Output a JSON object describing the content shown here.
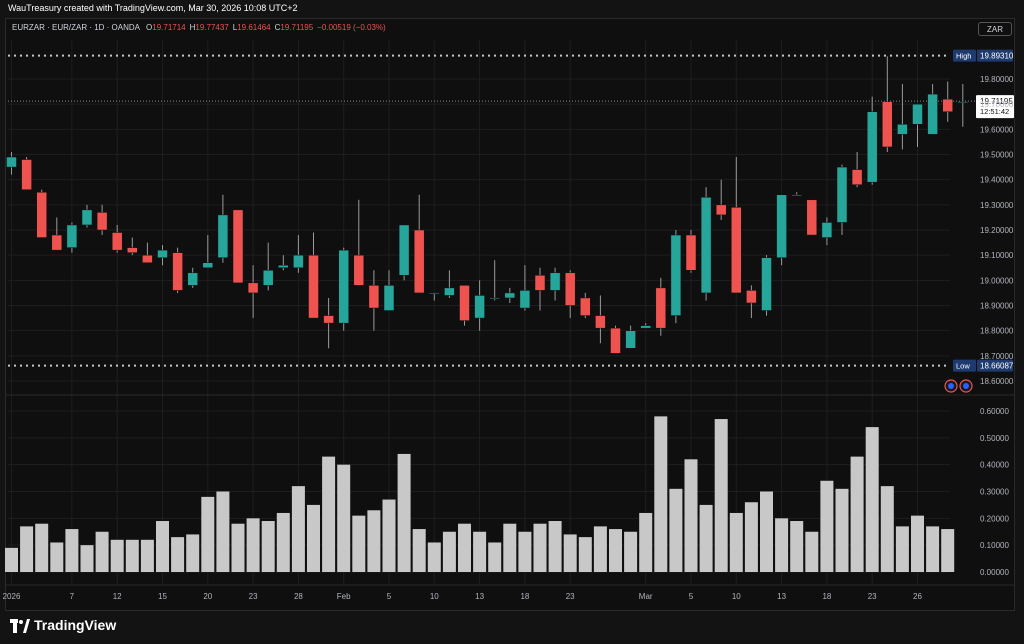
{
  "header": {
    "credit": "WauTreasury created with TradingView.com, Mar 30, 2026 10:08 UTC+2"
  },
  "legend": {
    "symbol": "EURZAR · EUR/ZAR · 1D · OANDA",
    "o_label": "O",
    "o_value": "19.71714",
    "h_label": "H",
    "h_value": "19.77437",
    "l_label": "L",
    "l_value": "19.61464",
    "c_label": "C",
    "c_value": "19.71195",
    "change": "−0.00519 (−0.03%)"
  },
  "currency_button": "ZAR",
  "footer": {
    "brand": "TradingView"
  },
  "colors": {
    "up": "#26a69a",
    "down": "#ef5350",
    "volume": "#c8c8c8",
    "grid": "#1e1e1e",
    "background": "#0f0f0f"
  },
  "chart_data": [
    {
      "type": "candlestick",
      "price_axis": {
        "range": [
          18.6,
          19.9
        ],
        "ticks": [
          "19.80000",
          "19.70000",
          "19.60000",
          "19.50000",
          "19.40000",
          "19.30000",
          "19.20000",
          "19.10000",
          "19.00000",
          "18.90000",
          "18.80000",
          "18.70000",
          "18.60000"
        ]
      },
      "x_ticks": [
        {
          "label": "2026",
          "i": 0
        },
        {
          "label": "7",
          "i": 4
        },
        {
          "label": "12",
          "i": 7
        },
        {
          "label": "15",
          "i": 10
        },
        {
          "label": "20",
          "i": 13
        },
        {
          "label": "23",
          "i": 16
        },
        {
          "label": "28",
          "i": 19
        },
        {
          "label": "Feb",
          "i": 22
        },
        {
          "label": "5",
          "i": 25
        },
        {
          "label": "10",
          "i": 28
        },
        {
          "label": "13",
          "i": 31
        },
        {
          "label": "18",
          "i": 34
        },
        {
          "label": "23",
          "i": 37
        },
        {
          "label": "Mar",
          "i": 42
        },
        {
          "label": "5",
          "i": 45
        },
        {
          "label": "10",
          "i": 48
        },
        {
          "label": "13",
          "i": 51
        },
        {
          "label": "18",
          "i": 54
        },
        {
          "label": "23",
          "i": 57
        },
        {
          "label": "26",
          "i": 60
        }
      ],
      "high_marker": {
        "label": "High",
        "value": "19.89310"
      },
      "low_marker": {
        "label": "Low",
        "value": "18.66087"
      },
      "last_price": {
        "value": "19.71195",
        "countdown": "12:51:42"
      },
      "candles": [
        [
          19.45,
          19.51,
          19.42,
          19.49
        ],
        [
          19.48,
          19.49,
          19.36,
          19.36
        ],
        [
          19.35,
          19.36,
          19.17,
          19.17
        ],
        [
          19.18,
          19.25,
          19.12,
          19.12
        ],
        [
          19.13,
          19.23,
          19.11,
          19.22
        ],
        [
          19.22,
          19.3,
          19.21,
          19.28
        ],
        [
          19.27,
          19.3,
          19.18,
          19.2
        ],
        [
          19.19,
          19.22,
          19.11,
          19.12
        ],
        [
          19.13,
          19.17,
          19.1,
          19.11
        ],
        [
          19.1,
          19.15,
          19.08,
          19.07
        ],
        [
          19.09,
          19.14,
          19.06,
          19.12
        ],
        [
          19.11,
          19.13,
          18.95,
          18.96
        ],
        [
          18.98,
          19.05,
          18.97,
          19.03
        ],
        [
          19.05,
          19.18,
          19.05,
          19.07
        ],
        [
          19.09,
          19.34,
          19.07,
          19.26
        ],
        [
          19.28,
          19.28,
          18.99,
          18.99
        ],
        [
          18.99,
          19.06,
          18.85,
          18.95
        ],
        [
          18.98,
          19.15,
          18.96,
          19.04
        ],
        [
          19.05,
          19.1,
          19.04,
          19.06
        ],
        [
          19.05,
          19.18,
          19.03,
          19.1
        ],
        [
          19.1,
          19.19,
          18.86,
          18.85
        ],
        [
          18.86,
          18.93,
          18.73,
          18.83
        ],
        [
          18.83,
          19.13,
          18.8,
          19.12
        ],
        [
          19.1,
          19.32,
          19.02,
          18.98
        ],
        [
          18.98,
          19.04,
          18.8,
          18.89
        ],
        [
          18.88,
          19.04,
          18.88,
          18.98
        ],
        [
          19.02,
          19.22,
          19.0,
          19.22
        ],
        [
          19.2,
          19.34,
          18.95,
          18.95
        ],
        [
          18.95,
          18.95,
          18.92,
          18.95
        ],
        [
          18.94,
          19.04,
          18.93,
          18.97
        ],
        [
          18.98,
          18.98,
          18.82,
          18.84
        ],
        [
          18.85,
          19.0,
          18.8,
          18.94
        ],
        [
          18.93,
          19.08,
          18.92,
          18.93
        ],
        [
          18.93,
          18.97,
          18.91,
          18.95
        ],
        [
          18.89,
          19.06,
          18.88,
          18.96
        ],
        [
          19.02,
          19.05,
          18.88,
          18.96
        ],
        [
          18.96,
          19.05,
          18.92,
          19.03
        ],
        [
          19.03,
          19.04,
          18.85,
          18.9
        ],
        [
          18.93,
          18.95,
          18.85,
          18.86
        ],
        [
          18.86,
          18.94,
          18.75,
          18.81
        ],
        [
          18.81,
          18.82,
          18.71,
          18.71
        ],
        [
          18.73,
          18.82,
          18.73,
          18.8
        ],
        [
          18.81,
          18.83,
          18.81,
          18.82
        ],
        [
          18.97,
          19.01,
          18.78,
          18.81
        ],
        [
          18.86,
          19.2,
          18.83,
          19.18
        ],
        [
          19.18,
          19.2,
          19.03,
          19.04
        ],
        [
          18.95,
          19.37,
          18.92,
          19.33
        ],
        [
          19.3,
          19.4,
          19.24,
          19.26
        ],
        [
          19.29,
          19.49,
          18.95,
          18.95
        ],
        [
          18.96,
          18.98,
          18.85,
          18.91
        ],
        [
          18.88,
          19.1,
          18.86,
          19.09
        ],
        [
          19.09,
          19.34,
          19.06,
          19.34
        ],
        [
          19.34,
          19.35,
          19.34,
          19.34
        ],
        [
          19.32,
          19.32,
          19.18,
          19.18
        ],
        [
          19.17,
          19.25,
          19.14,
          19.23
        ],
        [
          19.23,
          19.46,
          19.18,
          19.45
        ],
        [
          19.44,
          19.51,
          19.37,
          19.38
        ],
        [
          19.39,
          19.73,
          19.38,
          19.67
        ],
        [
          19.71,
          19.89,
          19.51,
          19.53
        ],
        [
          19.58,
          19.78,
          19.52,
          19.62
        ],
        [
          19.62,
          19.7,
          19.53,
          19.7
        ],
        [
          19.58,
          19.78,
          19.58,
          19.74
        ],
        [
          19.72,
          19.79,
          19.63,
          19.67
        ],
        [
          19.71,
          19.78,
          19.61,
          19.71
        ]
      ]
    },
    {
      "type": "bar",
      "series_role": "volume",
      "y_axis": {
        "range": [
          0,
          0.6
        ],
        "ticks": [
          "0.60000",
          "0.50000",
          "0.40000",
          "0.30000",
          "0.20000",
          "0.10000",
          "0.00000"
        ]
      },
      "values": [
        0.09,
        0.17,
        0.18,
        0.11,
        0.16,
        0.1,
        0.15,
        0.12,
        0.12,
        0.12,
        0.19,
        0.13,
        0.14,
        0.28,
        0.3,
        0.18,
        0.2,
        0.19,
        0.22,
        0.32,
        0.25,
        0.43,
        0.4,
        0.21,
        0.23,
        0.27,
        0.44,
        0.16,
        0.11,
        0.15,
        0.18,
        0.15,
        0.11,
        0.18,
        0.15,
        0.18,
        0.19,
        0.14,
        0.13,
        0.17,
        0.16,
        0.15,
        0.22,
        0.58,
        0.31,
        0.42,
        0.25,
        0.57,
        0.22,
        0.26,
        0.3,
        0.2,
        0.19,
        0.15,
        0.34,
        0.31,
        0.43,
        0.54,
        0.32,
        0.17,
        0.21,
        0.17,
        0.16
      ]
    }
  ]
}
